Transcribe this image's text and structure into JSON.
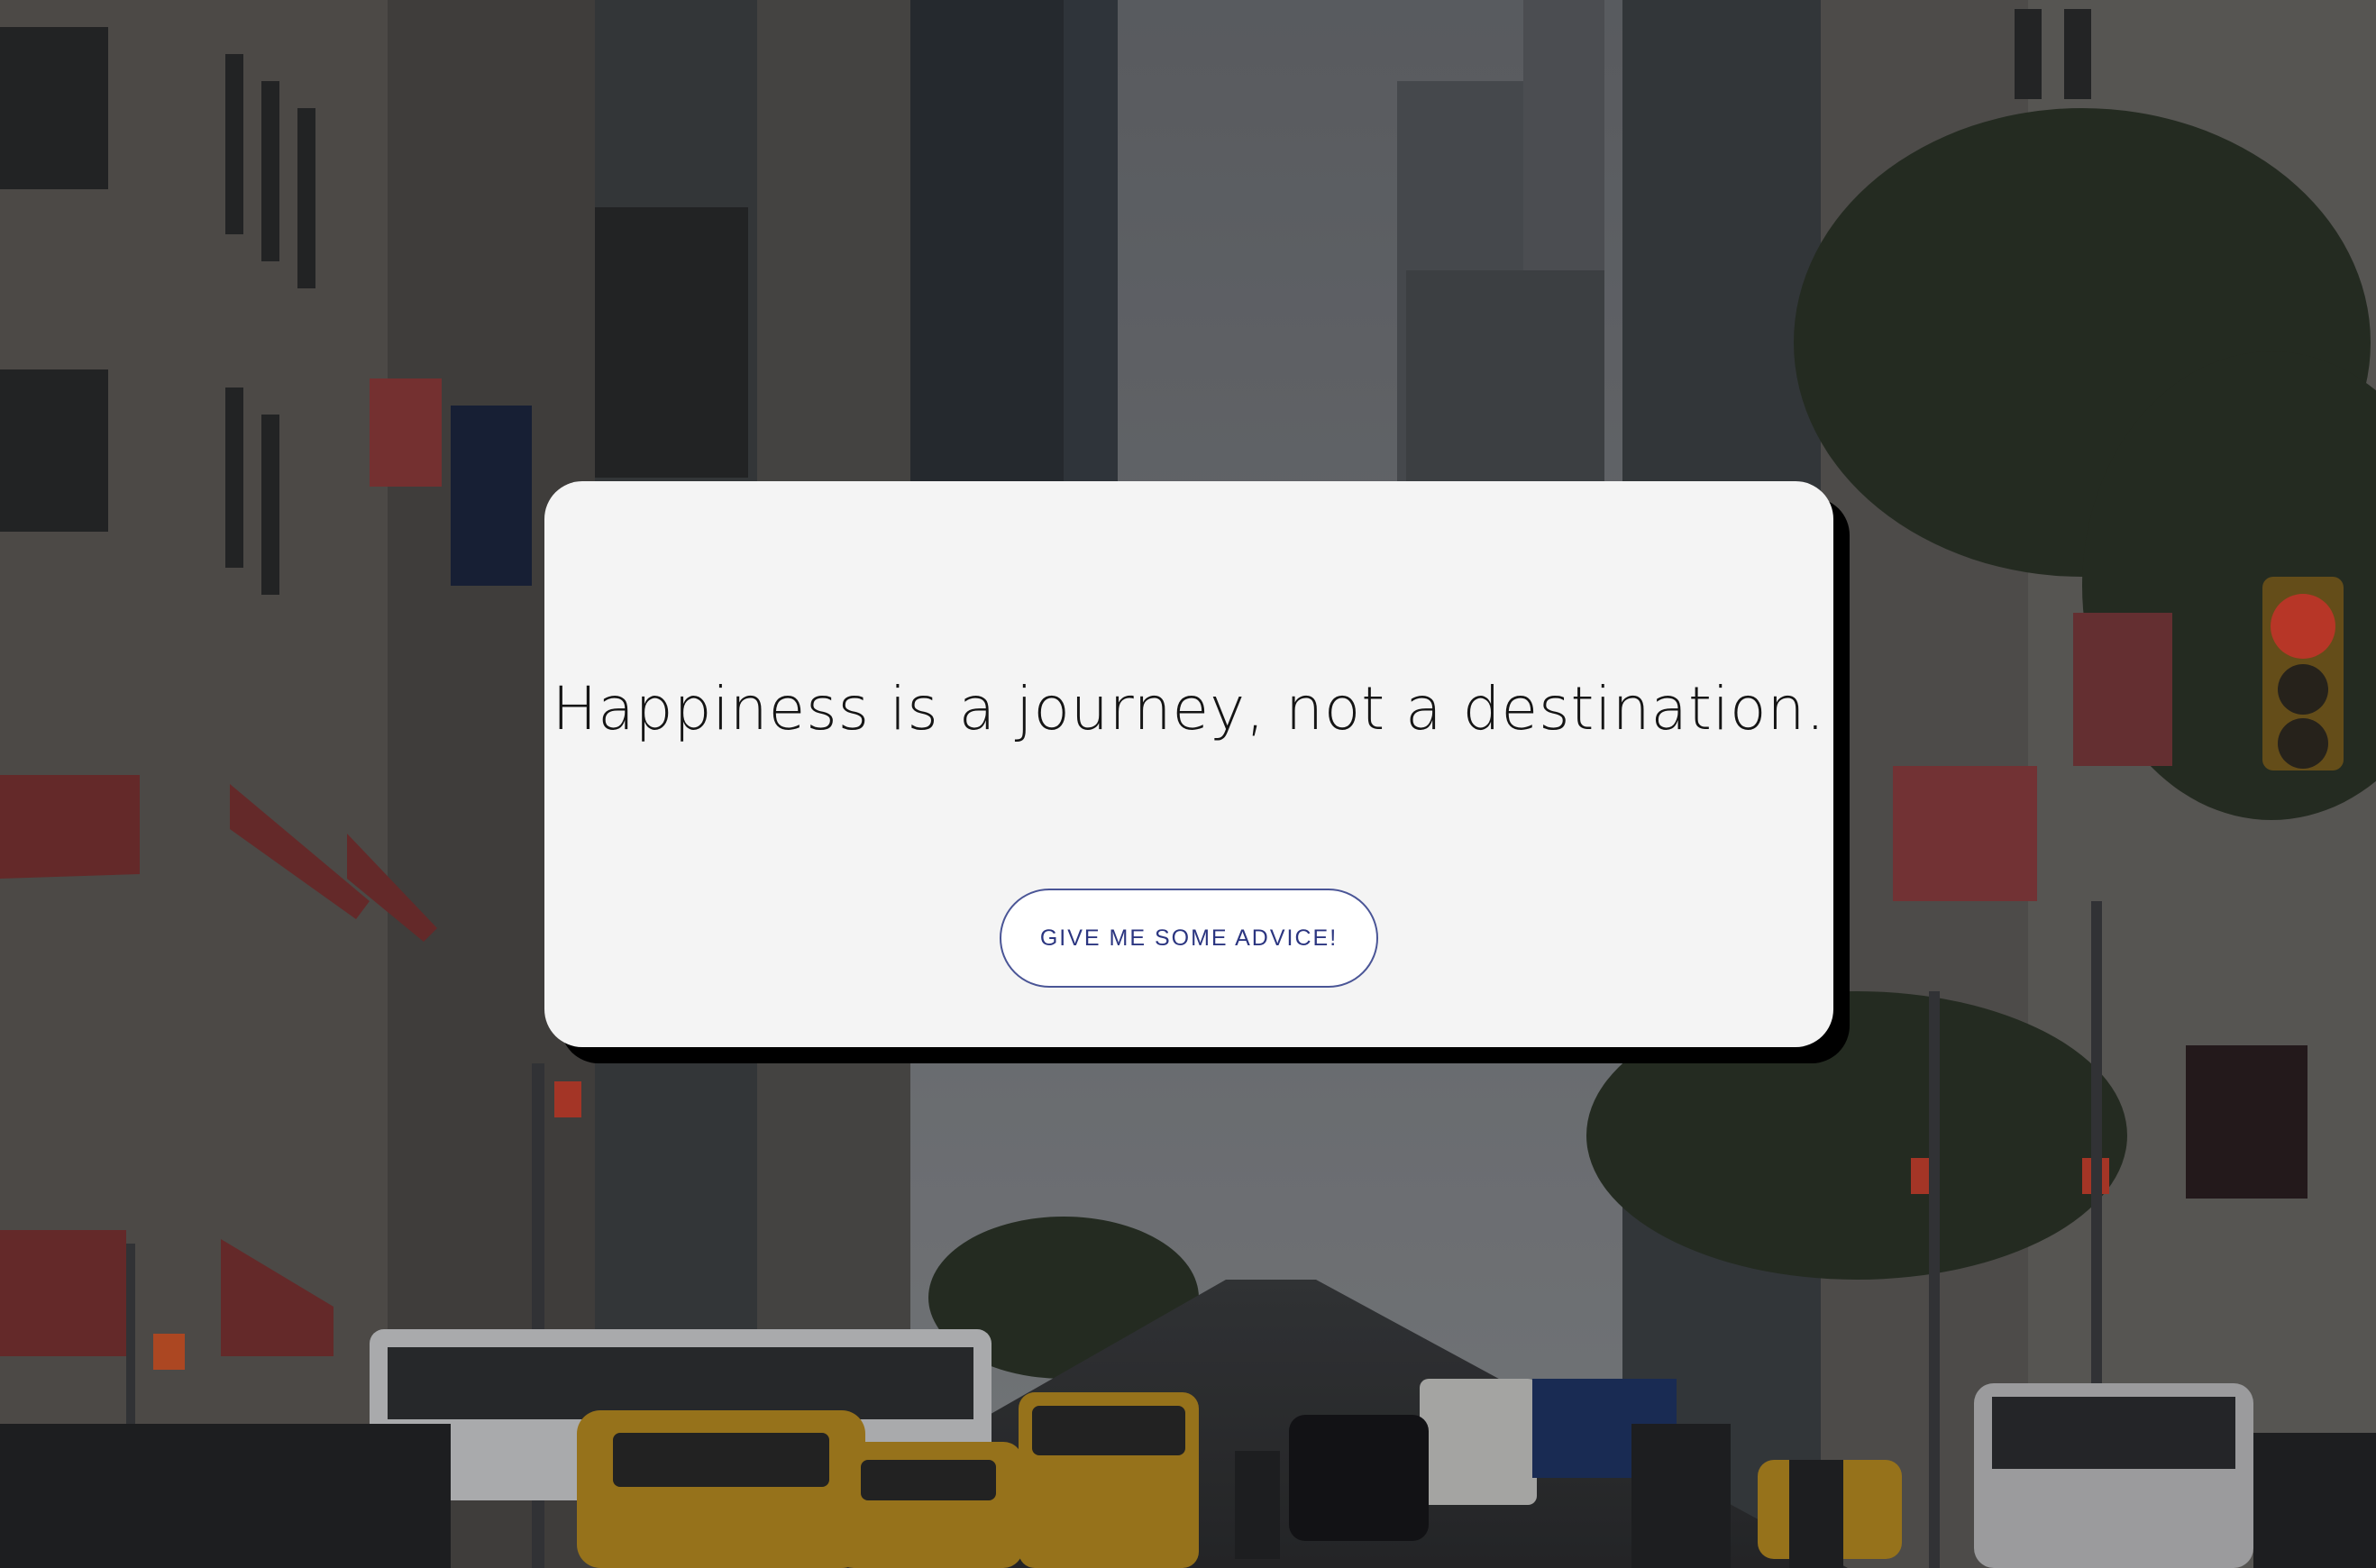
{
  "background": {
    "scene": "city-street-photo"
  },
  "card": {
    "quote": "Happiness is a journey, not a destination.",
    "button_label": "GIVE ME SOME ADVICE!"
  },
  "colors": {
    "card_bg": "#f4f4f4",
    "card_shadow": "#000000",
    "button_text": "#2b3580",
    "button_border": "#4a5596",
    "quote_text": "#151515"
  }
}
